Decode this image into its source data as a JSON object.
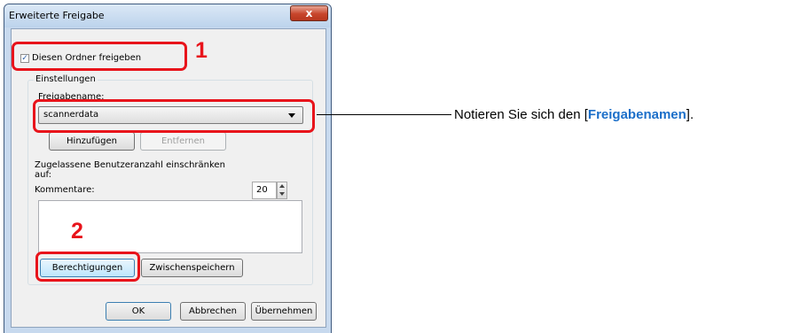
{
  "dialog": {
    "title": "Erweiterte Freigabe",
    "close_label": "x",
    "share_checkbox_label": "Diesen Ordner freigeben",
    "settings_group_title": "Einstellungen",
    "share_name_label": "Freigabename:",
    "share_name_value": "scannerdata",
    "add_button": "Hinzufügen",
    "remove_button": "Entfernen",
    "limit_label_line1": "Zugelassene Benutzeranzahl einschränken",
    "limit_label_line2": "auf:",
    "limit_value": "20",
    "comments_label": "Kommentare:",
    "permissions_button": "Berechtigungen",
    "caching_button": "Zwischenspeichern",
    "ok_button": "OK",
    "cancel_button": "Abbrechen",
    "apply_button": "Übernehmen"
  },
  "annotations": {
    "step1": "1",
    "step2": "2",
    "note_prefix": "Notieren Sie sich den [",
    "note_keyword": "Freigabenamen",
    "note_suffix": "].",
    "highlight_color": "#e8141b",
    "keyword_color": "#1c6fc9"
  }
}
